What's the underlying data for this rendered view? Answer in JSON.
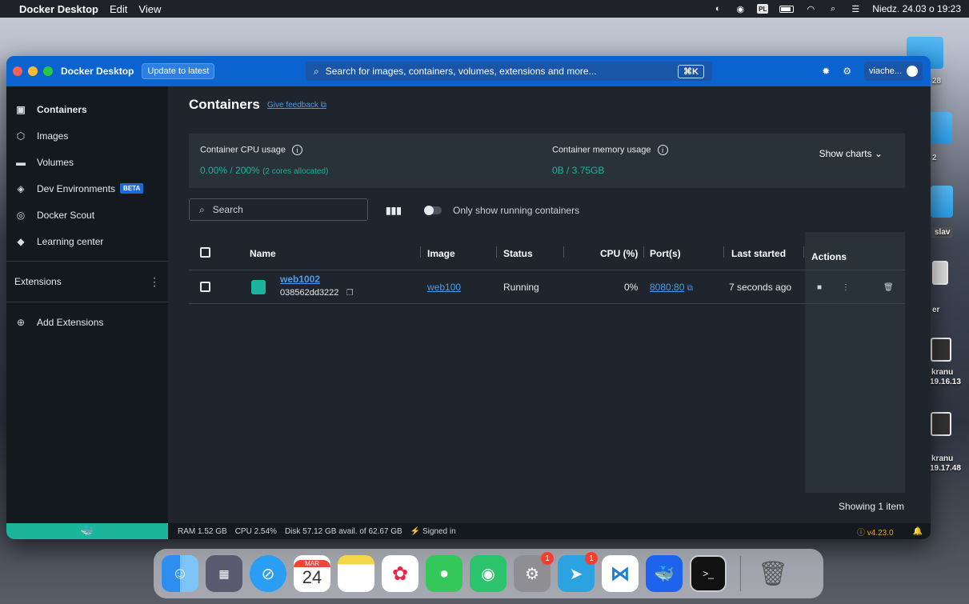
{
  "menubar": {
    "app": "Docker Desktop",
    "menus": [
      "Edit",
      "View"
    ],
    "datetime": "Niedz. 24.03 o 19:23",
    "input_source": "PL"
  },
  "desktop": {
    "labels": [
      "28",
      "2",
      "slav",
      "er",
      "kranu",
      "19.16.13",
      "kranu",
      "19.17.48"
    ]
  },
  "window": {
    "title": "Docker Desktop",
    "update_button": "Update to latest",
    "search_placeholder": "Search for images, containers, volumes, extensions and more...",
    "search_shortcut": "⌘K",
    "user": "viache..."
  },
  "sidebar": {
    "items": [
      {
        "label": "Containers",
        "icon": "containers-icon"
      },
      {
        "label": "Images",
        "icon": "images-icon"
      },
      {
        "label": "Volumes",
        "icon": "volumes-icon"
      },
      {
        "label": "Dev Environments",
        "icon": "dev-environments-icon",
        "badge": "BETA"
      },
      {
        "label": "Docker Scout",
        "icon": "docker-scout-icon"
      },
      {
        "label": "Learning center",
        "icon": "learning-center-icon"
      }
    ],
    "extensions_label": "Extensions",
    "add_extensions": "Add Extensions"
  },
  "main": {
    "title": "Containers",
    "feedback": "Give feedback",
    "cpu_label": "Container CPU usage",
    "cpu_value": "0.00% / 200%",
    "cpu_sub": "(2 cores allocated)",
    "mem_label": "Container memory usage",
    "mem_value": "0B / 3.75GB",
    "show_charts": "Show charts",
    "search_placeholder": "Search",
    "only_running": "Only show running containers",
    "columns": {
      "name": "Name",
      "image": "Image",
      "status": "Status",
      "cpu": "CPU (%)",
      "ports": "Port(s)",
      "last_started": "Last started",
      "actions": "Actions"
    },
    "rows": [
      {
        "name": "web1002",
        "id": "038562dd3222",
        "image": "web100",
        "status": "Running",
        "cpu": "0%",
        "port": "8080:80",
        "last_started": "7 seconds ago"
      }
    ],
    "showing": "Showing 1 item"
  },
  "footer": {
    "ram": "RAM 1.52 GB",
    "cpu": "CPU 2.54%",
    "disk": "Disk 57.12 GB avail. of 62.67 GB",
    "signed_in": "Signed in",
    "version": "v4.23.0"
  },
  "dock": {
    "calendar_month": "MAR",
    "calendar_day": "24",
    "badge_settings": "1",
    "badge_telegram": "1"
  },
  "colors": {
    "accent_blue": "#0b63d0",
    "running_green": "#1bb59c",
    "link_blue": "#4a9bf0"
  }
}
